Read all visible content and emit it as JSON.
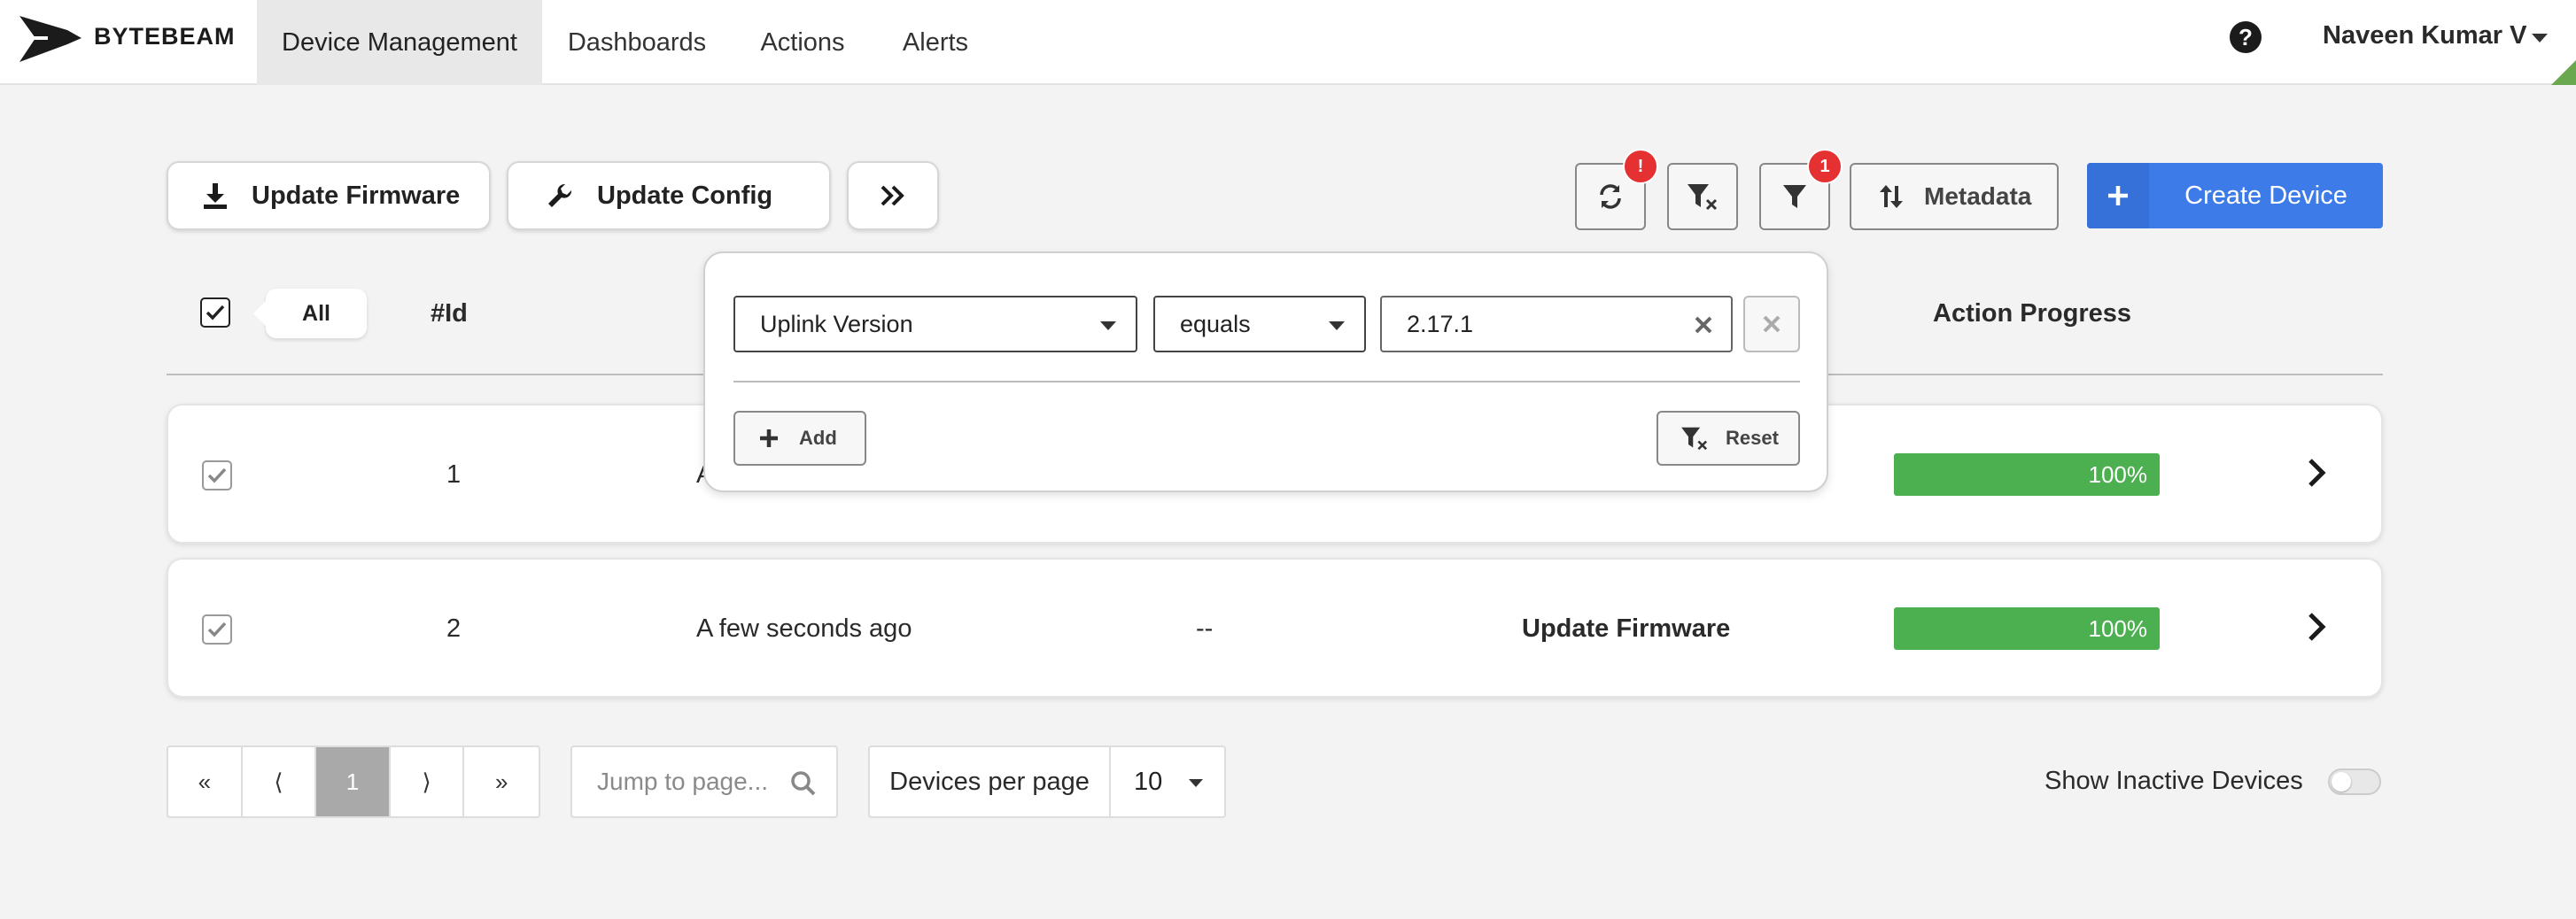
{
  "brand": {
    "name": "BYTEBEAM"
  },
  "nav": {
    "tabs": [
      {
        "label": "Device Management",
        "active": true
      },
      {
        "label": "Dashboards"
      },
      {
        "label": "Actions"
      },
      {
        "label": "Alerts"
      }
    ],
    "user": "Naveen Kumar V"
  },
  "toolbar": {
    "update_firmware": "Update Firmware",
    "update_config": "Update Config",
    "refresh_badge": "!",
    "filter_badge": "1",
    "metadata": "Metadata",
    "create_device": "Create Device"
  },
  "table": {
    "all_label": "All",
    "headers": {
      "id": "#Id",
      "action_progress": "Action Progress"
    },
    "rows": [
      {
        "id": "1",
        "last_seen": "A",
        "progress": "100%"
      },
      {
        "id": "2",
        "last_seen": "A few seconds ago",
        "metadata": "--",
        "action": "Update Firmware",
        "progress": "100%"
      }
    ]
  },
  "filter": {
    "field": "Uplink Version",
    "operator": "equals",
    "value": "2.17.1",
    "add": "Add",
    "reset": "Reset"
  },
  "pagination": {
    "first": "«",
    "prev": "⟨",
    "current": "1",
    "next": "⟩",
    "last": "»",
    "jump_placeholder": "Jump to page...",
    "per_page_label": "Devices per page",
    "per_page_value": "10",
    "show_inactive_label": "Show Inactive Devices",
    "show_inactive": false
  },
  "colors": {
    "primary": "#3c7be8",
    "progress": "#4caf50",
    "badge": "#e53131"
  }
}
